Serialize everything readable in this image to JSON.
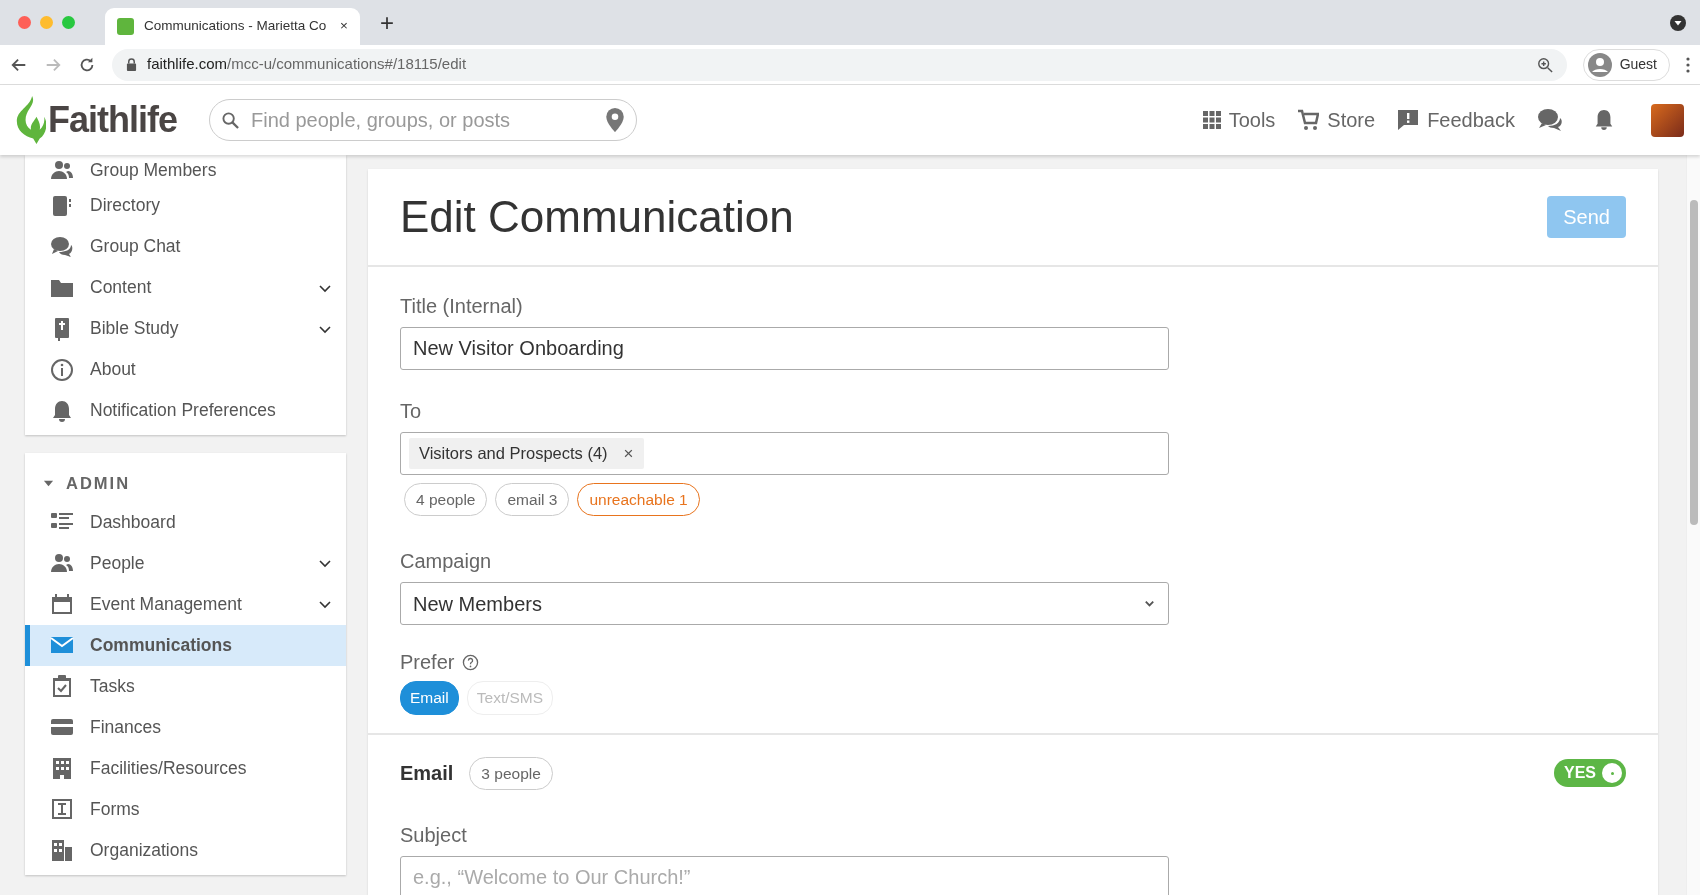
{
  "browser": {
    "tab": {
      "title": "Communications - Marietta Co",
      "close": "×"
    },
    "new_tab": "+",
    "url": {
      "domain": "faithlife.com",
      "path": "/mcc-u/communications#/18115/edit"
    },
    "profile": "Guest"
  },
  "header": {
    "logo": "Faithlife",
    "search": {
      "placeholder": "Find people, groups, or posts"
    },
    "nav": [
      {
        "label": "Tools"
      },
      {
        "label": "Store"
      },
      {
        "label": "Feedback"
      }
    ]
  },
  "sidebar": {
    "groups": [
      {
        "items": [
          {
            "label": "Group Members",
            "expandable": false,
            "selected": false
          },
          {
            "label": "Directory",
            "expandable": false,
            "selected": false
          },
          {
            "label": "Group Chat",
            "expandable": false,
            "selected": false
          },
          {
            "label": "Content",
            "expandable": true,
            "selected": false
          },
          {
            "label": "Bible Study",
            "expandable": true,
            "selected": false
          },
          {
            "label": "About",
            "expandable": false,
            "selected": false
          },
          {
            "label": "Notification Preferences",
            "expandable": false,
            "selected": false
          }
        ]
      },
      {
        "heading": "ADMIN",
        "expanded": true,
        "items": [
          {
            "label": "Dashboard",
            "expandable": false,
            "selected": false
          },
          {
            "label": "People",
            "expandable": true,
            "selected": false
          },
          {
            "label": "Event Management",
            "expandable": true,
            "selected": false
          },
          {
            "label": "Communications",
            "expandable": false,
            "selected": true
          },
          {
            "label": "Tasks",
            "expandable": false,
            "selected": false
          },
          {
            "label": "Finances",
            "expandable": false,
            "selected": false
          },
          {
            "label": "Facilities/Resources",
            "expandable": false,
            "selected": false
          },
          {
            "label": "Forms",
            "expandable": false,
            "selected": false
          },
          {
            "label": "Organizations",
            "expandable": false,
            "selected": false
          }
        ]
      }
    ]
  },
  "main": {
    "title": "Edit Communication",
    "send_button": {
      "label": "Send",
      "disabled": true
    },
    "title_field": {
      "label": "Title (Internal)",
      "value": "New Visitor Onboarding"
    },
    "to_field": {
      "label": "To",
      "tokens": [
        {
          "label": "Visitors and Prospects (4)",
          "remove": "×"
        }
      ]
    },
    "recipient_badges": [
      {
        "label": "4 people",
        "warning": false
      },
      {
        "label": "email 3",
        "warning": false
      },
      {
        "label": "unreachable 1",
        "warning": true
      }
    ],
    "campaign": {
      "label": "Campaign",
      "value": "New Members"
    },
    "prefer": {
      "label": "Prefer",
      "options": [
        {
          "label": "Email",
          "selected": true
        },
        {
          "label": "Text/SMS",
          "selected": false
        }
      ]
    },
    "email_section": {
      "title": "Email",
      "badge": "3 people",
      "enabled": true,
      "toggle_label": "YES"
    },
    "subject": {
      "label": "Subject",
      "placeholder": "e.g., “Welcome to Our Church!”"
    }
  }
}
